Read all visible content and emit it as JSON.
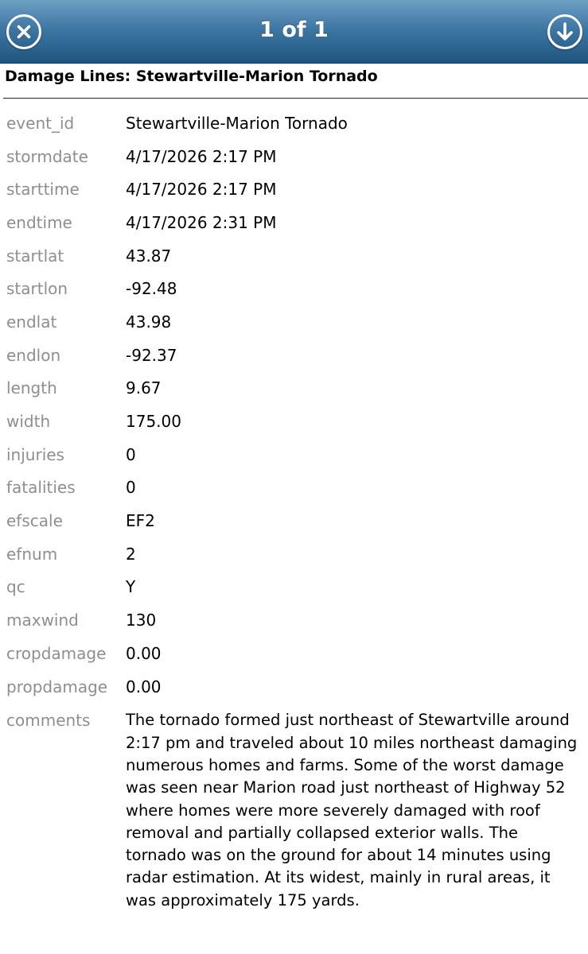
{
  "header": {
    "title": "1 of 1",
    "close_icon": "close-circle-icon",
    "download_icon": "arrow-down-circle-icon",
    "bar_color": "#3f77a3"
  },
  "layer_title": "Damage Lines: Stewartville-Marion Tornado",
  "attributes": [
    {
      "key": "event_id",
      "value": "Stewartville-Marion Tornado"
    },
    {
      "key": "stormdate",
      "value": "4/17/2026 2:17 PM"
    },
    {
      "key": "starttime",
      "value": "4/17/2026 2:17 PM"
    },
    {
      "key": "endtime",
      "value": "4/17/2026 2:31 PM"
    },
    {
      "key": "startlat",
      "value": "43.87"
    },
    {
      "key": "startlon",
      "value": "-92.48"
    },
    {
      "key": "endlat",
      "value": "43.98"
    },
    {
      "key": "endlon",
      "value": "-92.37"
    },
    {
      "key": "length",
      "value": "9.67"
    },
    {
      "key": "width",
      "value": "175.00"
    },
    {
      "key": "injuries",
      "value": "0"
    },
    {
      "key": "fatalities",
      "value": "0"
    },
    {
      "key": "efscale",
      "value": "EF2"
    },
    {
      "key": "efnum",
      "value": "2"
    },
    {
      "key": "qc",
      "value": "Y"
    },
    {
      "key": "maxwind",
      "value": "130"
    },
    {
      "key": "cropdamage",
      "value": "0.00"
    },
    {
      "key": "propdamage",
      "value": "0.00"
    },
    {
      "key": "comments",
      "value": "The tornado formed just northeast of Stewartville around 2:17 pm and traveled about 10 miles northeast damaging numerous homes and farms. Some of the worst damage was seen near Marion road just northeast of Highway 52 where homes were more severely damaged with roof removal and partially collapsed exterior walls. The tornado was on the ground for about 14 minutes using radar estimation. At its widest, mainly in rural areas, it was approximately 175 yards."
    }
  ]
}
